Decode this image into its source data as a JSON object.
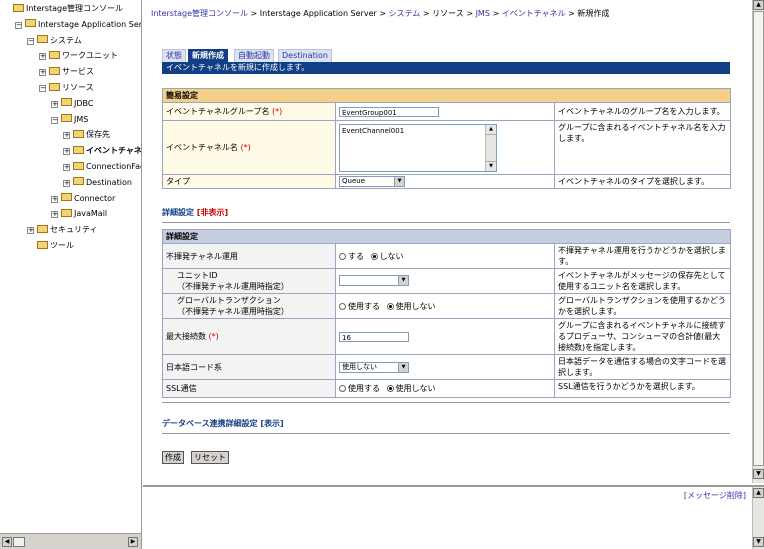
{
  "tree": {
    "items": [
      {
        "label": "Interstage管理コンソール",
        "indent": 0
      },
      {
        "label": "Interstage Application Server",
        "indent": 1
      },
      {
        "label": "システム",
        "indent": 2
      },
      {
        "label": "ワークユニット",
        "indent": 3
      },
      {
        "label": "サービス",
        "indent": 3
      },
      {
        "label": "リソース",
        "indent": 3
      },
      {
        "label": "JDBC",
        "indent": 4
      },
      {
        "label": "JMS",
        "indent": 4
      },
      {
        "label": "保存先",
        "indent": 5
      },
      {
        "label": "イベントチャネ",
        "indent": 5
      },
      {
        "label": "ConnectionFac",
        "indent": 5
      },
      {
        "label": "Destination",
        "indent": 5
      },
      {
        "label": "Connector",
        "indent": 4
      },
      {
        "label": "JavaMail",
        "indent": 4
      },
      {
        "label": "セキュリティ",
        "indent": 2
      },
      {
        "label": "ツール",
        "indent": 2
      }
    ]
  },
  "breadcrumb": {
    "items": [
      "Interstage管理コンソール",
      "Interstage Application Server",
      "システム",
      "リソース",
      "JMS",
      "イベントチャネル",
      "新規作成"
    ],
    "separator": ">"
  },
  "tabs": [
    {
      "label": "状態",
      "active": false
    },
    {
      "label": "新規作成",
      "active": true
    },
    {
      "label": "自動起動",
      "active": false
    },
    {
      "label": "Destination",
      "active": false
    }
  ],
  "tab_desc": "イベントチャネルを新規に作成します。",
  "simple": {
    "header": "簡易設定",
    "group_label": "イベントチャネルグループ名",
    "group_value": "EventGroup001",
    "group_help": "イベントチャネルのグループ名を入力します。",
    "name_label": "イベントチャネル名",
    "name_value": "EventChannel001",
    "name_help": "グループに含まれるイベントチャネル名を入力します。",
    "type_label": "タイプ",
    "type_value": "Queue",
    "type_help": "イベントチャネルのタイプを選択します。",
    "required_mark": "(*)"
  },
  "detail_toggle": {
    "label": "詳細設定",
    "link": "[非表示]"
  },
  "detail": {
    "header": "詳細設定",
    "rows": {
      "volatile": {
        "label": "不揮発チャネル運用",
        "opt1": "する",
        "opt2": "しない",
        "help": "不揮発チャネル運用を行うかどうかを選択します。"
      },
      "unit": {
        "label1": "ユニットID",
        "label2": "（不揮発チャネル運用時指定）",
        "help": "イベントチャネルがメッセージの保存先として使用するユニット名を選択します。"
      },
      "gtx": {
        "label1": "グローバルトランザクション",
        "label2": "（不揮発チャネル運用時指定）",
        "opt1": "使用する",
        "opt2": "使用しない",
        "help": "グローバルトランザクションを使用するかどうかを選択します。"
      },
      "maxconn": {
        "label": "最大接続数",
        "value": "16",
        "help": "グループに含まれるイベントチャネルに接続するプロデューサ、コンシューマの合計値(最大接続数)を指定します。"
      },
      "jcode": {
        "label": "日本語コード系",
        "value": "使用しない",
        "help": "日本語データを通信する場合の文字コードを選択します。"
      },
      "ssl": {
        "label": "SSL通信",
        "opt1": "使用する",
        "opt2": "使用しない",
        "help": "SSL通信を行うかどうかを選択します。"
      }
    }
  },
  "db_toggle": {
    "label": "データベース連携詳細設定",
    "link": "[表示]"
  },
  "buttons": {
    "create": "作成",
    "reset": "リセット"
  },
  "message_pane": {
    "clear_link": "[メッセージ削除]"
  }
}
